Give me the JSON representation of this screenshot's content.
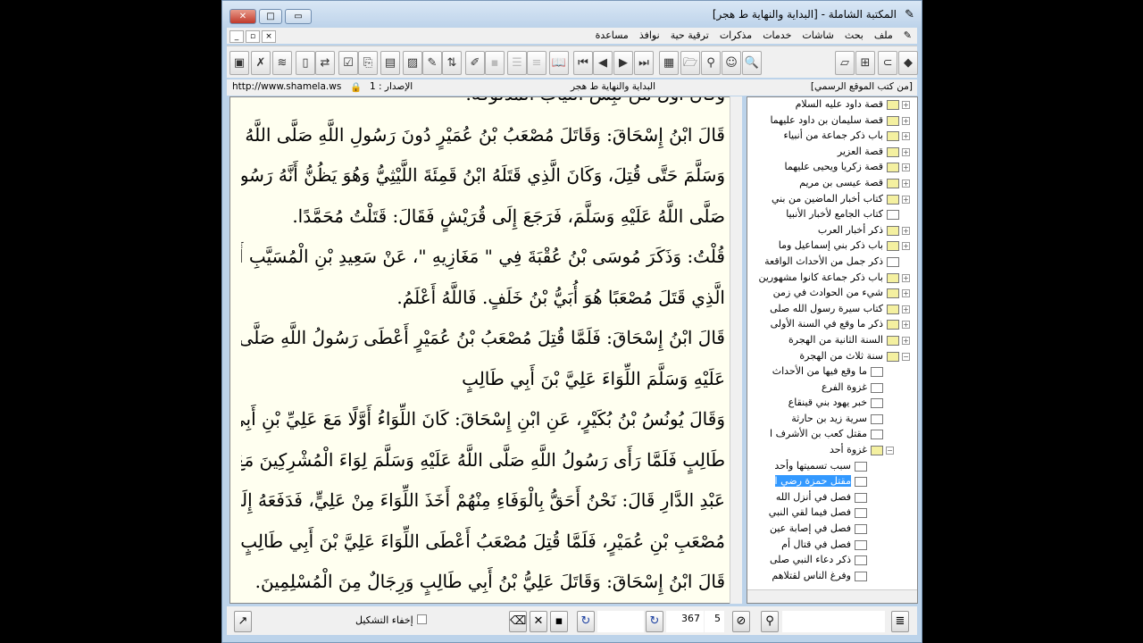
{
  "window": {
    "title": "المكتبة الشاملة - [البداية والنهاية ط هجر]"
  },
  "menu": [
    "ملف",
    "بحث",
    "شاشات",
    "خدمات",
    "مذكرات",
    "ترقية حية",
    "نوافذ",
    "مساعدة"
  ],
  "info": {
    "source": "[من كتب الموقع الرسمي]",
    "book": "البداية والنهاية ط هجر",
    "version": "الإصدار : 1",
    "url": "http://www.shamela.ws"
  },
  "text": [
    "وَكَانَ أَوَّلَ مَنْ لَبِسَ الثِّيَابَ الْمَدْلُوكَةَ.",
    "قَالَ ابْنُ إِسْحَاقَ: وَقَاتَلَ مُصْعَبُ بْنُ عُمَيْرٍ دُونَ رَسُولِ اللَّهِ صَلَّى اللَّهُ عَلَيْهِ",
    "وَسَلَّمَ حَتَّى قُتِلَ، وَكَانَ الَّذِي قَتَلَهُ ابْنُ قَمِئَةَ اللَّيْثِيُّ وَهُوَ يَظُنُّ أَنَّهُ رَسُولُ اللَّهِ",
    "صَلَّى اللَّهُ عَلَيْهِ وَسَلَّمَ، فَرَجَعَ إِلَى قُرَيْشٍ فَقَالَ: قَتَلْتُ مُحَمَّدًا.",
    "قُلْتُ: وَذَكَرَ مُوسَى بْنُ عُقْبَةَ فِي \" مَغَازِيهِ \"، عَنْ سَعِيدِ بْنِ الْمُسَيَّبِ أَنَّ",
    "الَّذِي قَتَلَ مُصْعَبًا هُوَ أُبَيُّ بْنُ خَلَفٍ. فَاللَّهُ أَعْلَمُ.",
    "قَالَ ابْنُ إِسْحَاقَ: فَلَمَّا قُتِلَ مُصْعَبُ بْنُ عُمَيْرٍ أَعْطَى رَسُولُ اللَّهِ صَلَّى اللَّهُ",
    "عَلَيْهِ وَسَلَّمَ اللِّوَاءَ عَلِيَّ بْنَ أَبِي طَالِبٍ",
    "وَقَالَ يُونُسُ بْنُ بُكَيْرٍ، عَنِ ابْنِ إِسْحَاقَ: كَانَ اللِّوَاءُ أَوَّلًا مَعَ عَلِيِّ بْنِ أَبِي",
    "طَالِبٍ فَلَمَّا رَأَى رَسُولُ اللَّهِ صَلَّى اللَّهُ عَلَيْهِ وَسَلَّمَ لِوَاءَ الْمُشْرِكِينَ مَعَ بَنِي",
    "عَبْدِ الدَّارِ قَالَ: نَحْنُ أَحَقُّ بِالْوَفَاءِ مِنْهُمْ أَخَذَ اللِّوَاءَ مِنْ عَلِيٍّ، فَدَفَعَهُ إِلَى",
    "مُصْعَبِ بْنِ عُمَيْرٍ، فَلَمَّا قُتِلَ مُصْعَبُ أَعْطَى اللِّوَاءَ عَلِيَّ بْنَ أَبِي طَالِبٍ..",
    "قَالَ ابْنُ إِسْحَاقَ: وَقَاتَلَ عَلِيُّ بْنُ أَبِي طَالِبٍ وَرِجَالٌ مِنَ الْمُسْلِمِينَ."
  ],
  "tree": [
    {
      "label": "قصة داود عليه السلام",
      "level": 0,
      "folder": true
    },
    {
      "label": "قصة سليمان بن داود عليهما",
      "level": 0,
      "folder": true
    },
    {
      "label": "باب ذكر جماعة من أنبياء",
      "level": 0,
      "folder": true
    },
    {
      "label": "قصة العزير",
      "level": 0,
      "folder": true
    },
    {
      "label": "قصة زكريا ويحيى عليهما",
      "level": 0,
      "folder": true
    },
    {
      "label": "قصة عيسى بن مريم",
      "level": 0,
      "folder": true
    },
    {
      "label": "كتاب أخبار الماضين من بني",
      "level": 0,
      "folder": true
    },
    {
      "label": "كتاب الجامع لأخبار الأنبيا",
      "level": 0,
      "folder": false
    },
    {
      "label": "ذكر أخبار العرب",
      "level": 0,
      "folder": true
    },
    {
      "label": "باب ذكر بني إسماعيل وما",
      "level": 0,
      "folder": true
    },
    {
      "label": "ذكر جمل من الأحداث الواقعة",
      "level": 0,
      "folder": false
    },
    {
      "label": "باب ذكر جماعة كانوا مشهورين",
      "level": 0,
      "folder": true
    },
    {
      "label": "شيء من الحوادث في زمن",
      "level": 0,
      "folder": true
    },
    {
      "label": "كتاب سيرة رسول الله صلى",
      "level": 0,
      "folder": true
    },
    {
      "label": "ذكر ما وقع في السنة الأولى",
      "level": 0,
      "folder": true
    },
    {
      "label": "السنة الثانية من الهجرة",
      "level": 0,
      "folder": true
    },
    {
      "label": "سنة ثلاث من الهجرة",
      "level": 0,
      "folder": true,
      "open": true
    },
    {
      "label": "ما وقع فيها من الأحداث",
      "level": 1,
      "folder": false
    },
    {
      "label": "غزوة الفرع",
      "level": 1,
      "folder": false
    },
    {
      "label": "خبر يهود بني قينقاع",
      "level": 1,
      "folder": false
    },
    {
      "label": "سرية زيد بن حارثة",
      "level": 1,
      "folder": false
    },
    {
      "label": "مقتل كعب بن الأشرف ا",
      "level": 1,
      "folder": false
    },
    {
      "label": "غزوة أحد",
      "level": 1,
      "folder": true,
      "open": true
    },
    {
      "label": "سبب تسميتها وأحد",
      "level": 2,
      "folder": false
    },
    {
      "label": "مقتل حمزة رضي ا",
      "level": 2,
      "folder": false,
      "selected": true
    },
    {
      "label": "فصل في أنزل الله",
      "level": 2,
      "folder": false
    },
    {
      "label": "فصل فيما لقي النبي",
      "level": 2,
      "folder": false
    },
    {
      "label": "فصل في إصابة عين",
      "level": 2,
      "folder": false
    },
    {
      "label": "فصل في قتال أم",
      "level": 2,
      "folder": false
    },
    {
      "label": "ذكر دعاء النبي صلى",
      "level": 2,
      "folder": false
    },
    {
      "label": "وفرغ الناس لقتلاهم",
      "level": 2,
      "folder": false
    }
  ],
  "status": {
    "hide_diacritics": "إخفاء التشكيل",
    "page": "367",
    "part": "5"
  }
}
